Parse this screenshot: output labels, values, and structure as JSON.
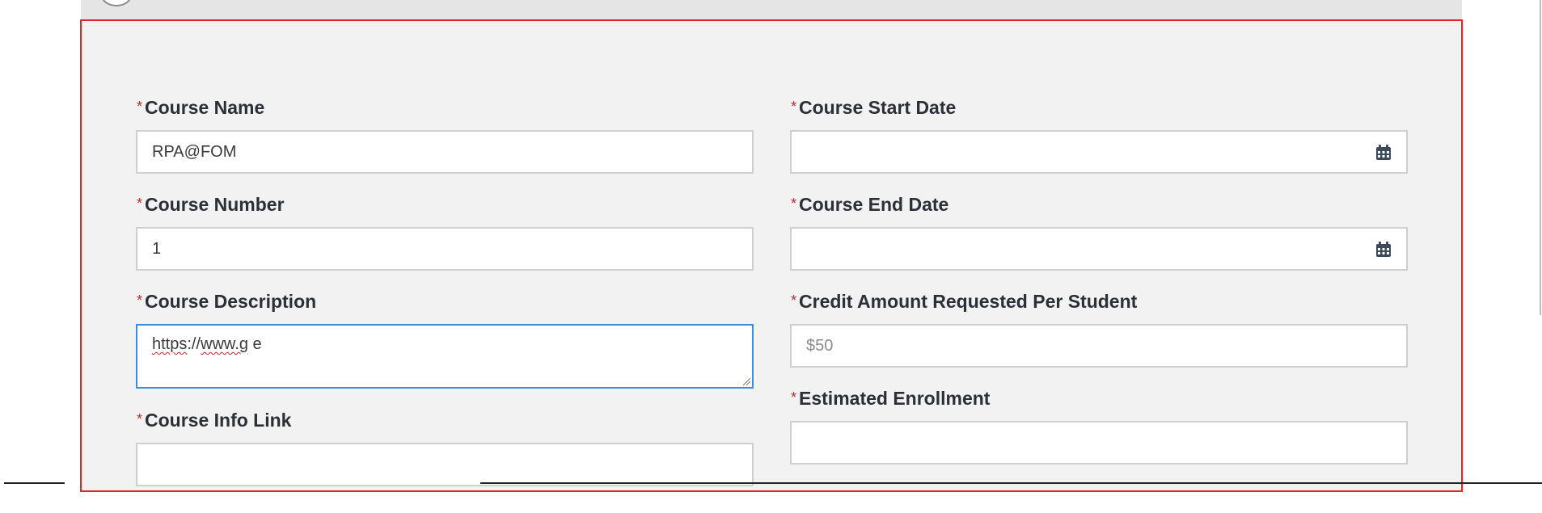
{
  "required_marker": "*",
  "left_column": {
    "course_name": {
      "label": "Course Name",
      "value": "RPA@FOM"
    },
    "course_number": {
      "label": "Course Number",
      "value": "1"
    },
    "course_description": {
      "label": "Course Description",
      "value_part1": "https",
      "value_part2": "://",
      "value_part3": "www.g",
      "value_part4": " e"
    },
    "course_info_link": {
      "label": "Course Info Link",
      "value": ""
    }
  },
  "right_column": {
    "course_start_date": {
      "label": "Course Start Date",
      "value": "",
      "icon": "calendar-icon"
    },
    "course_end_date": {
      "label": "Course End Date",
      "value": "",
      "icon": "calendar-icon"
    },
    "credit_amount": {
      "label": "Credit Amount Requested Per Student",
      "placeholder": "$50"
    },
    "estimated_enrollment": {
      "label": "Estimated Enrollment",
      "value": ""
    }
  },
  "colors": {
    "required": "#d0232b",
    "focus_border": "#3b8fd8",
    "highlight_border": "#e0262d",
    "panel_bg": "#f2f2f2",
    "icon": "#3c4a5c"
  }
}
